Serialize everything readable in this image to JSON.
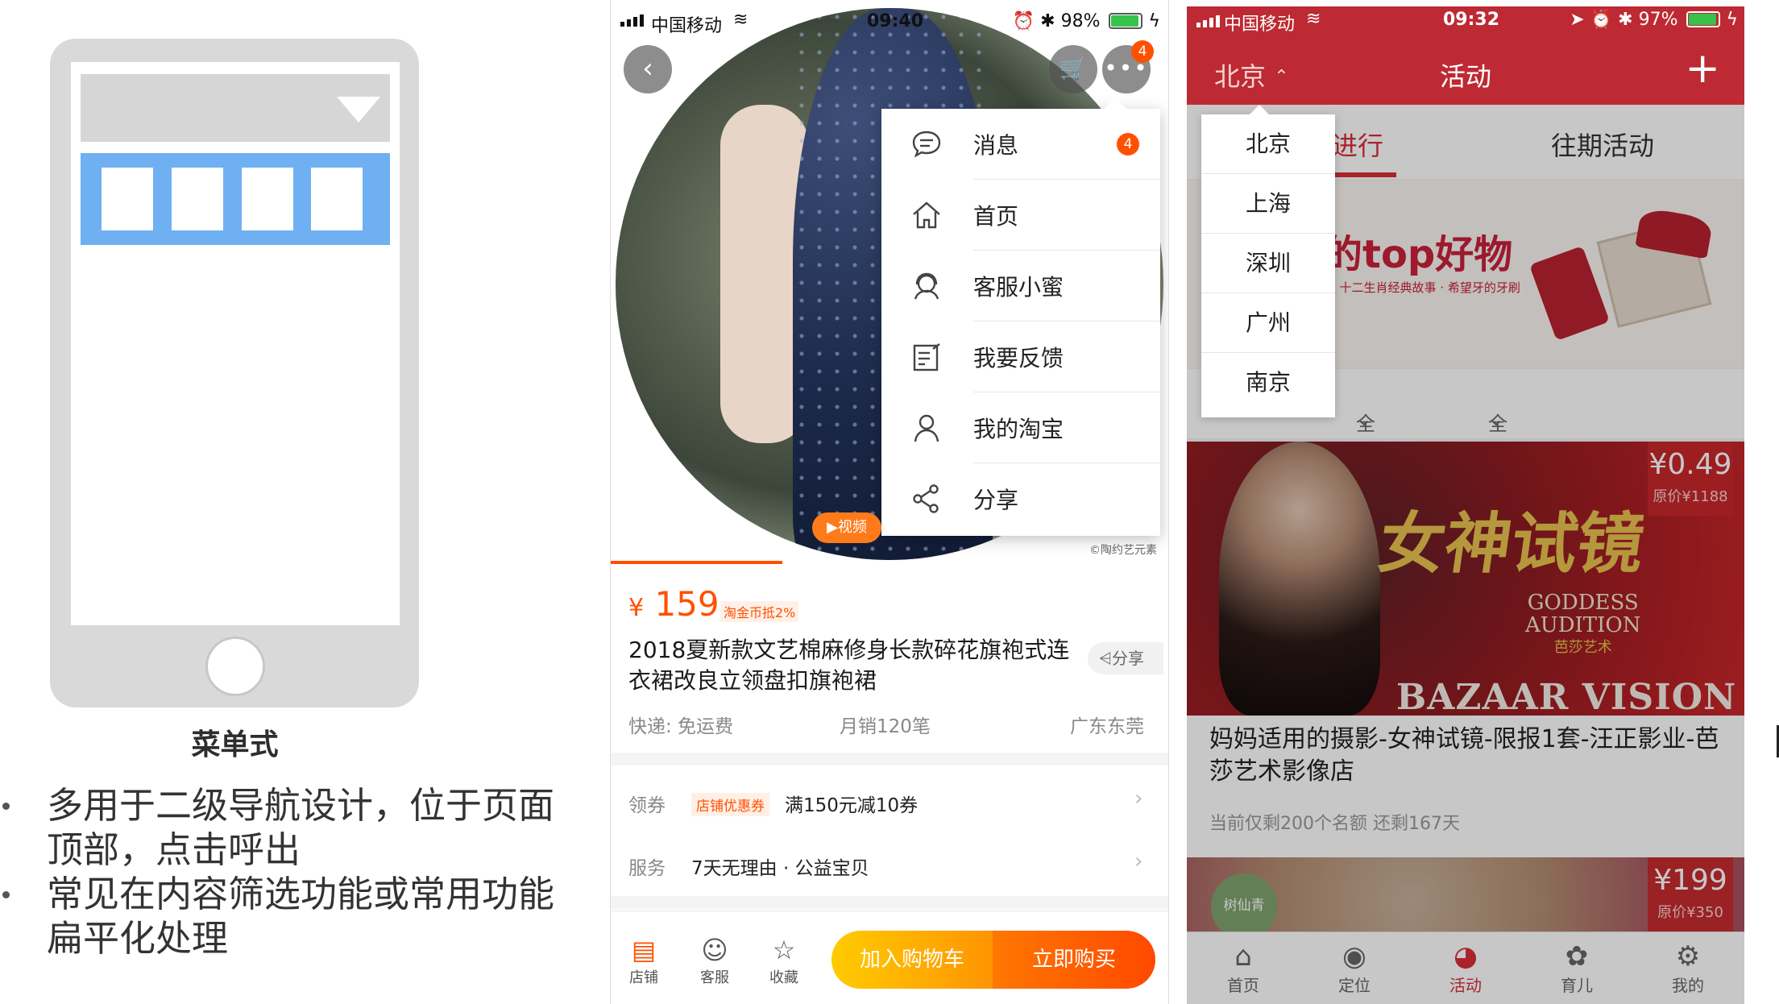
{
  "left": {
    "caption": "菜单式",
    "bullets": [
      "多用于二级导航设计，位于页面顶部，点击呼出",
      "常见在内容筛选功能或常用功能扁平化处理"
    ]
  },
  "mid": {
    "status": {
      "carrier": "中国移动",
      "time": "09:40",
      "battery": "98%"
    },
    "top_badge": "4",
    "menu": [
      {
        "label": "消息",
        "icon": "message-icon",
        "badge": "4"
      },
      {
        "label": "首页",
        "icon": "home-icon"
      },
      {
        "label": "客服小蜜",
        "icon": "customer-service-icon"
      },
      {
        "label": "我要反馈",
        "icon": "feedback-icon"
      },
      {
        "label": "我的淘宝",
        "icon": "user-icon"
      },
      {
        "label": "分享",
        "icon": "share-icon"
      }
    ],
    "video_label": "▶视频",
    "watermark": "©陶约艺元素",
    "price_symbol": "¥",
    "price": "159",
    "coin_tag": "淘金币抵2%",
    "title": "2018夏新款文艺棉麻修身长款碎花旗袍式连衣裙改良立领盘扣旗袍裙",
    "share": "分享",
    "shipping": "快递: 免运费",
    "sales": "月销120笔",
    "location": "广东东莞",
    "coupon_label": "领券",
    "coupon_tag": "店铺优惠券",
    "coupon_text": "满150元减10券",
    "service_label": "服务",
    "service_text": "7天无理由 · 公益宝贝",
    "bottom": {
      "shop": "店铺",
      "service": "客服",
      "favorite": "收藏",
      "add_cart": "加入购物车",
      "buy_now": "立即购买"
    }
  },
  "right": {
    "status": {
      "carrier": "中国移动",
      "time": "09:32",
      "battery": "97%"
    },
    "city": "北京",
    "title": "活动",
    "plus": "+",
    "tabs": [
      "进行",
      "往期活动"
    ],
    "banner_big": "的top好物",
    "banner_sub": "· 十二生肖经典故事 · 希望牙的牙刷",
    "filters": [
      "全部分类",
      "全部年龄"
    ],
    "cities": [
      "北京",
      "上海",
      "深圳",
      "广州",
      "南京"
    ],
    "card1": {
      "calligraphy": "女神试镜",
      "goddess": "GODDESS",
      "audition": "AUDITION",
      "brand_cn": "芭莎艺术",
      "bazaar": "BAZAAR VISION",
      "price": "¥0.49",
      "orig": "原价¥1188",
      "title": "妈妈适用的摄影-女神试镜-限报1套-汪正影业-芭莎艺术影像店",
      "sub": "当前仅剩200个名额 还剩167天"
    },
    "card2": {
      "badge": "树仙青",
      "price": "¥199",
      "orig": "原价¥350"
    },
    "tabbar": [
      "首页",
      "定位",
      "活动",
      "育儿",
      "我的"
    ],
    "accent": "#bd2a33"
  }
}
